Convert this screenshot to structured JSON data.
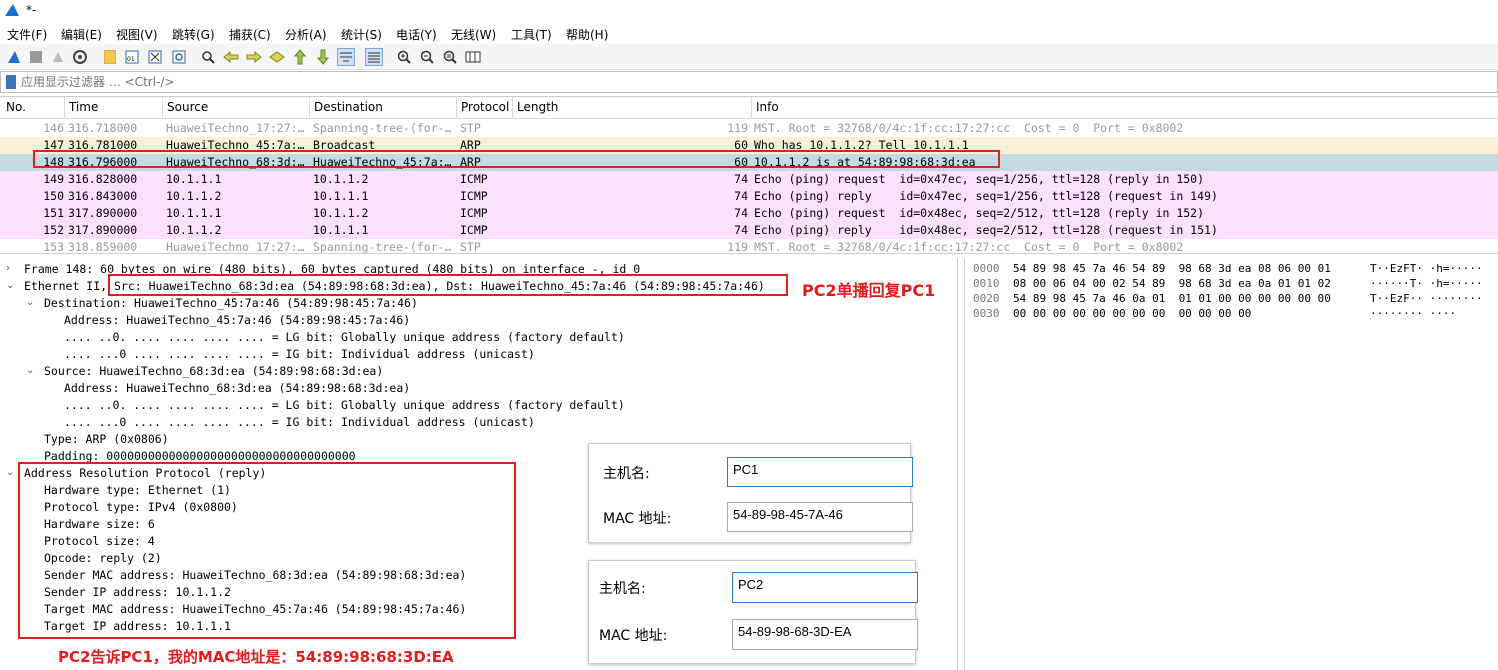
{
  "window": {
    "title": "*-"
  },
  "menu": [
    "文件(F)",
    "编辑(E)",
    "视图(V)",
    "跳转(G)",
    "捕获(C)",
    "分析(A)",
    "统计(S)",
    "电话(Y)",
    "无线(W)",
    "工具(T)",
    "帮助(H)"
  ],
  "toolbar_icons": [
    "shark-fin-start-icon",
    "stop-icon",
    "restart-icon",
    "options-icon",
    "open-file-icon",
    "save-icon",
    "close-file-icon",
    "reload-icon",
    "find-icon",
    "back-icon",
    "forward-icon",
    "goto-icon",
    "first-icon",
    "last-icon",
    "autoscroll-icon",
    "colorize-icon",
    "zoom-in-icon",
    "zoom-out-icon",
    "zoom-reset-icon",
    "resize-columns-icon"
  ],
  "filter": {
    "placeholder": "应用显示过滤器 … <Ctrl-/>"
  },
  "columns": [
    "No.",
    "Time",
    "Source",
    "Destination",
    "Protocol",
    "Length",
    "Info"
  ],
  "packets": [
    {
      "no": "146",
      "time": "316.718000",
      "src": "HuaweiTechno_17:27:…",
      "dst": "Spanning-tree-(for-…",
      "proto": "STP",
      "len": "119",
      "info": "MST. Root = 32768/0/4c:1f:cc:17:27:cc  Cost = 0  Port = 0x8002",
      "style": "stp"
    },
    {
      "no": "147",
      "time": "316.781000",
      "src": "HuaweiTechno_45:7a:…",
      "dst": "Broadcast",
      "proto": "ARP",
      "len": "60",
      "info": "Who has 10.1.1.2? Tell 10.1.1.1",
      "style": "arp"
    },
    {
      "no": "148",
      "time": "316.796000",
      "src": "HuaweiTechno_68:3d:…",
      "dst": "HuaweiTechno_45:7a:…",
      "proto": "ARP",
      "len": "60",
      "info": "10.1.1.2 is at 54:89:98:68:3d:ea",
      "style": "selected"
    },
    {
      "no": "149",
      "time": "316.828000",
      "src": "10.1.1.1",
      "dst": "10.1.1.2",
      "proto": "ICMP",
      "len": "74",
      "info": "Echo (ping) request  id=0x47ec, seq=1/256, ttl=128 (reply in 150)",
      "style": "icmp"
    },
    {
      "no": "150",
      "time": "316.843000",
      "src": "10.1.1.2",
      "dst": "10.1.1.1",
      "proto": "ICMP",
      "len": "74",
      "info": "Echo (ping) reply    id=0x47ec, seq=1/256, ttl=128 (request in 149)",
      "style": "icmp"
    },
    {
      "no": "151",
      "time": "317.890000",
      "src": "10.1.1.1",
      "dst": "10.1.1.2",
      "proto": "ICMP",
      "len": "74",
      "info": "Echo (ping) request  id=0x48ec, seq=2/512, ttl=128 (reply in 152)",
      "style": "icmp"
    },
    {
      "no": "152",
      "time": "317.890000",
      "src": "10.1.1.2",
      "dst": "10.1.1.1",
      "proto": "ICMP",
      "len": "74",
      "info": "Echo (ping) reply    id=0x48ec, seq=2/512, ttl=128 (request in 151)",
      "style": "icmp"
    },
    {
      "no": "153",
      "time": "318.859000",
      "src": "HuaweiTechno_17:27:…",
      "dst": "Spanning-tree-(for-…",
      "proto": "STP",
      "len": "119",
      "info": "MST. Root = 32768/0/4c:1f:cc:17:27:cc  Cost = 0  Port = 0x8002",
      "style": "stp"
    }
  ],
  "details": [
    {
      "arrow": ">",
      "indent": 0,
      "text": "Frame 148: 60 bytes on wire (480 bits), 60 bytes captured (480 bits) on interface -, id 0"
    },
    {
      "arrow": "v",
      "indent": 0,
      "text": "Ethernet II, Src: HuaweiTechno_68:3d:ea (54:89:98:68:3d:ea), Dst: HuaweiTechno_45:7a:46 (54:89:98:45:7a:46)"
    },
    {
      "arrow": "v",
      "indent": 1,
      "text": "Destination: HuaweiTechno_45:7a:46 (54:89:98:45:7a:46)"
    },
    {
      "arrow": "",
      "indent": 2,
      "text": "Address: HuaweiTechno_45:7a:46 (54:89:98:45:7a:46)"
    },
    {
      "arrow": "",
      "indent": 2,
      "text": ".... ..0. .... .... .... .... = LG bit: Globally unique address (factory default)"
    },
    {
      "arrow": "",
      "indent": 2,
      "text": ".... ...0 .... .... .... .... = IG bit: Individual address (unicast)"
    },
    {
      "arrow": "v",
      "indent": 1,
      "text": "Source: HuaweiTechno_68:3d:ea (54:89:98:68:3d:ea)"
    },
    {
      "arrow": "",
      "indent": 2,
      "text": "Address: HuaweiTechno_68:3d:ea (54:89:98:68:3d:ea)"
    },
    {
      "arrow": "",
      "indent": 2,
      "text": ".... ..0. .... .... .... .... = LG bit: Globally unique address (factory default)"
    },
    {
      "arrow": "",
      "indent": 2,
      "text": ".... ...0 .... .... .... .... = IG bit: Individual address (unicast)"
    },
    {
      "arrow": "",
      "indent": 1,
      "text": "Type: ARP (0x0806)"
    },
    {
      "arrow": "",
      "indent": 1,
      "text": "Padding: 000000000000000000000000000000000000"
    },
    {
      "arrow": "v",
      "indent": 0,
      "text": "Address Resolution Protocol (reply)"
    },
    {
      "arrow": "",
      "indent": 1,
      "text": "Hardware type: Ethernet (1)"
    },
    {
      "arrow": "",
      "indent": 1,
      "text": "Protocol type: IPv4 (0x0800)"
    },
    {
      "arrow": "",
      "indent": 1,
      "text": "Hardware size: 6"
    },
    {
      "arrow": "",
      "indent": 1,
      "text": "Protocol size: 4"
    },
    {
      "arrow": "",
      "indent": 1,
      "text": "Opcode: reply (2)"
    },
    {
      "arrow": "",
      "indent": 1,
      "text": "Sender MAC address: HuaweiTechno_68:3d:ea (54:89:98:68:3d:ea)"
    },
    {
      "arrow": "",
      "indent": 1,
      "text": "Sender IP address: 10.1.1.2"
    },
    {
      "arrow": "",
      "indent": 1,
      "text": "Target MAC address: HuaweiTechno_45:7a:46 (54:89:98:45:7a:46)"
    },
    {
      "arrow": "",
      "indent": 1,
      "text": "Target IP address: 10.1.1.1"
    }
  ],
  "bytes": [
    {
      "off": "0000",
      "hex": "54 89 98 45 7a 46 54 89  98 68 3d ea 08 06 00 01",
      "ascii": "T··EzFT· ·h=·····"
    },
    {
      "off": "0010",
      "hex": "08 00 06 04 00 02 54 89  98 68 3d ea 0a 01 01 02",
      "ascii": "······T· ·h=·····"
    },
    {
      "off": "0020",
      "hex": "54 89 98 45 7a 46 0a 01  01 01 00 00 00 00 00 00",
      "ascii": "T··EzF·· ········"
    },
    {
      "off": "0030",
      "hex": "00 00 00 00 00 00 00 00  00 00 00 00",
      "ascii": "········ ····"
    }
  ],
  "annotations": {
    "pc2_unicast": "PC2单播回复PC1",
    "pc2_tells": "PC2告诉PC1，我的MAC地址是：54:89:98:68:3D:EA"
  },
  "cards": [
    {
      "host_label": "主机名:",
      "host_value": "PC1",
      "mac_label": "MAC 地址:",
      "mac_value": "54-89-98-45-7A-46"
    },
    {
      "host_label": "主机名:",
      "host_value": "PC2",
      "mac_label": "MAC 地址:",
      "mac_value": "54-89-98-68-3D-EA"
    }
  ],
  "colors": {
    "stp": "#ffffff",
    "arp": "#faf0d7",
    "selected": "#c5dae3",
    "icmp": "#fce0ff",
    "accent": "#e02020"
  }
}
